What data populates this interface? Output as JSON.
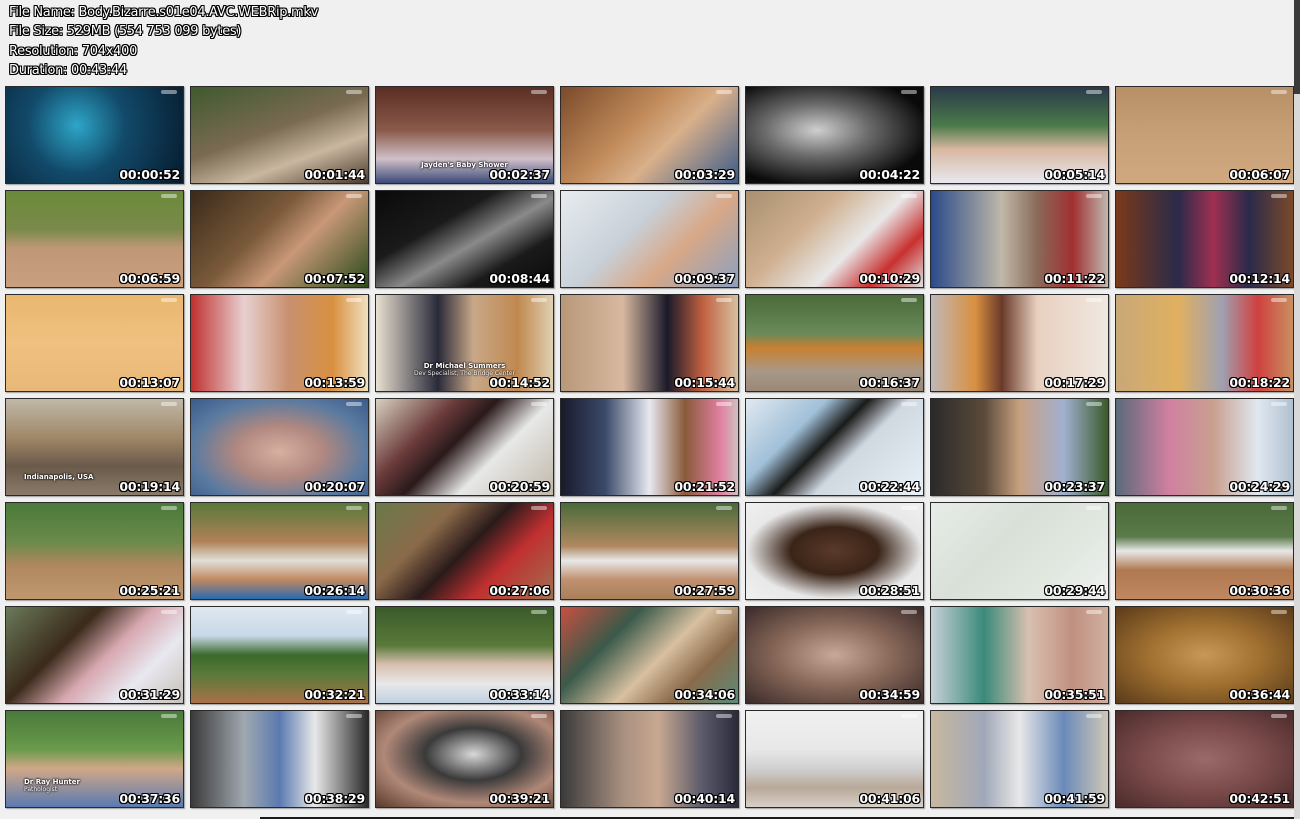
{
  "header": {
    "file_name": "File Name: Body.Bizarre.s01e04.AVC.WEBRip.mkv",
    "file_size": "File Size: 529MB (554 753 099 bytes)",
    "resolution": "Resolution: 704x400",
    "duration": "Duration: 00:43:44"
  },
  "thumbnails": [
    {
      "time": "00:00:52",
      "bg": "radial-gradient(circle at 40% 40%, #2ea6c8 0%, #124a6a 40%, #061a2c 100%)"
    },
    {
      "time": "00:01:44",
      "bg": "linear-gradient(160deg, #3f5a2e 0%, #7a6a52 45%, #c9b7a0 70%, #4b3a2c 100%)"
    },
    {
      "time": "00:02:37",
      "caption": "Jayden's Baby Shower",
      "bg": "linear-gradient(180deg, #5a2e24 0%, #8a5a4a 45%, #d0c0c8 75%, #3a4a78 100%)"
    },
    {
      "time": "00:03:29",
      "bg": "linear-gradient(135deg, #7a4a2a 0%, #c08a5a 40%, #d9b08a 60%, #3a5a8a 100%)"
    },
    {
      "time": "00:04:22",
      "bg": "radial-gradient(ellipse at 40% 45%, #cfcfcf 0%, #6a6a6a 35%, #0a0a0a 75%)"
    },
    {
      "time": "00:05:14",
      "bg": "linear-gradient(180deg, #2a3a4a 0%, #4a7a4a 40%, #d8b8a0 65%, #e8e8f0 100%)"
    },
    {
      "time": "00:06:07",
      "bg": "linear-gradient(180deg, #b89068 0%, #c8a078 50%, #d0a880 100%)"
    },
    {
      "time": "00:06:59",
      "bg": "linear-gradient(180deg, #6a8a3a 0%, #7a8a4a 40%, #c09878 60%, #c8a080 100%)"
    },
    {
      "time": "00:07:52",
      "bg": "linear-gradient(135deg, #3a2a1a 0%, #7a5a3a 40%, #c89878 60%, #2a4a1a 100%)"
    },
    {
      "time": "00:08:44",
      "bg": "linear-gradient(150deg, #0a0a0a 0%, #1a1a1a 35%, #8a8a8a 55%, #1a1a1a 75%, #0a0a0a 100%)"
    },
    {
      "time": "00:09:37",
      "bg": "linear-gradient(135deg, #e8ecf0 0%, #c8d0d8 40%, #d8a888 65%, #8aa0c0 100%)"
    },
    {
      "time": "00:10:29",
      "bg": "linear-gradient(135deg, #a89070 0%, #d0b090 35%, #e8e8e8 60%, #c83030 80%, #e0e0e0 100%)"
    },
    {
      "time": "00:11:22",
      "bg": "linear-gradient(90deg, #2a4a8a 0%, #c0b8a8 40%, #8a6a5a 60%, #a03030 80%, #c0b8b0 100%)"
    },
    {
      "time": "00:12:14",
      "bg": "linear-gradient(90deg, #7a3a1a 0%, #2a2a4a 35%, #a03050 55%, #2a2a4a 75%, #7a4a2a 100%)"
    },
    {
      "time": "00:13:07",
      "bg": "linear-gradient(180deg, #e8b870 0%, #f0c080 50%, #e8b878 100%)"
    },
    {
      "time": "00:13:59",
      "bg": "linear-gradient(90deg, #c03030 0%, #e8d0d0 30%, #c89070 55%, #d89040 80%, #f0e0c0 100%)"
    },
    {
      "time": "00:14:52",
      "caption": "Dr Michael Summers",
      "caption2": "Dev Specialist, The Bridge Center",
      "bg": "linear-gradient(90deg, #e8e0d0 0%, #2a2a3a 35%, #c8a888 55%, #c08850 80%, #e0d0b0 100%)"
    },
    {
      "time": "00:15:44",
      "bg": "linear-gradient(90deg, #b89878 0%, #d8b8a0 35%, #1a1a2a 60%, #c06040 80%, #d8c0a0 100%)"
    },
    {
      "time": "00:16:37",
      "bg": "linear-gradient(180deg, #4a6a3a 0%, #6a8a5a 40%, #c88030 55%, #a89888 80%, #9a8878 100%)"
    },
    {
      "time": "00:17:29",
      "bg": "linear-gradient(90deg, #c0b8b8 0%, #d89040 25%, #6a3a2a 40%, #e8d0c0 60%, #f0e8e0 100%)"
    },
    {
      "time": "00:18:22",
      "bg": "linear-gradient(90deg, #c8a878 0%, #e0b060 35%, #a0a0b0 60%, #d04040 80%, #c89060 100%)"
    },
    {
      "time": "00:19:14",
      "caption": "Indianapolis, USA",
      "caption_left": true,
      "bg": "linear-gradient(180deg, #c0b8a8 0%, #a08868 40%, #6a5a4a 70%, #8a7a6a 100%)"
    },
    {
      "time": "00:20:07",
      "bg": "radial-gradient(ellipse at 50% 55%, #d8b0a0 0%, #b08880 35%, #5a7aa0 70%, #3a5a8a 100%)"
    },
    {
      "time": "00:20:59",
      "bg": "linear-gradient(135deg, #d8d0c0 0%, #6a3a3a 30%, #2a1a1a 45%, #e8e8e8 65%, #c0b8a8 100%)"
    },
    {
      "time": "00:21:52",
      "bg": "linear-gradient(90deg, #1a1a2a 0%, #3a4a6a 25%, #e8e8f0 50%, #8a5a3a 70%, #e080a0 90%, #d0c0c0 100%)"
    },
    {
      "time": "00:22:44",
      "bg": "linear-gradient(135deg, #e0e8f0 0%, #a0c0d8 30%, #1a1a1a 45%, #d0d8e0 60%, #e8f0f8 100%)"
    },
    {
      "time": "00:23:37",
      "bg": "linear-gradient(90deg, #2a2a2a 0%, #5a4a3a 30%, #c8a080 50%, #a0b0d0 75%, #3a5a2a 100%)"
    },
    {
      "time": "00:24:29",
      "bg": "linear-gradient(90deg, #5a6a7a 0%, #d080a0 30%, #c8a090 55%, #e0e8f0 80%, #b0c0d0 100%)"
    },
    {
      "time": "00:25:21",
      "bg": "linear-gradient(180deg, #4a7a3a 0%, #6a8a4a 40%, #b08860 65%, #c09870 100%)"
    },
    {
      "time": "00:26:14",
      "bg": "linear-gradient(180deg, #5a7a3a 0%, #b08058 40%, #e0e0d8 60%, #c08860 80%, #2a6ab0 100%)"
    },
    {
      "time": "00:27:06",
      "bg": "linear-gradient(135deg, #6a7a4a 0%, #8a6a4a 30%, #2a1a1a 50%, #c03030 70%, #a07050 100%)"
    },
    {
      "time": "00:27:59",
      "bg": "linear-gradient(180deg, #4a6a3a 0%, #b08860 45%, #e8e8e8 60%, #c09070 80%, #a88058 100%)"
    },
    {
      "time": "00:28:51",
      "bg": "radial-gradient(ellipse at 50% 50%, #5a3a2a 0%, #3a2418 35%, #e8e8e8 70%, #f0f0f0 100%)"
    },
    {
      "time": "00:29:44",
      "bg": "linear-gradient(135deg, #e8ece8 0%, #d8e0d8 40%, #e0e8e0 70%, #f0f0f0 100%)"
    },
    {
      "time": "00:30:36",
      "bg": "linear-gradient(180deg, #4a6a3a 0%, #5a7a4a 35%, #e8e8e8 50%, #b07850 70%, #c08860 100%)"
    },
    {
      "time": "00:31:29",
      "bg": "linear-gradient(135deg, #6a7a5a 0%, #3a2a1a 35%, #d8a8b0 55%, #e8e8f0 75%, #c8c0b8 100%)"
    },
    {
      "time": "00:32:21",
      "bg": "linear-gradient(180deg, #e0e8f0 0%, #c8d8e8 30%, #3a6a2a 50%, #5a7a3a 70%, #a87048 100%)"
    },
    {
      "time": "00:33:14",
      "bg": "linear-gradient(180deg, #3a5a2a 0%, #5a7a3a 40%, #d8c0b0 60%, #e8e8e8 80%, #c0d0e0 100%)"
    },
    {
      "time": "00:34:06",
      "bg": "linear-gradient(135deg, #c85040 0%, #3a5a4a 30%, #d8c0a0 55%, #8a6a4a 75%, #5a8a7a 100%)"
    },
    {
      "time": "00:34:59",
      "bg": "radial-gradient(ellipse at 50% 50%, #c8a898 0%, #8a6a5a 45%, #3a2a2a 100%)"
    },
    {
      "time": "00:35:51",
      "bg": "linear-gradient(90deg, #c8d0d8 0%, #3a8a7a 30%, #d8c0b0 55%, #c09080 80%, #d0b0a0 100%)"
    },
    {
      "time": "00:36:44",
      "bg": "radial-gradient(ellipse at 50% 50%, #c89858 0%, #a07030 45%, #5a3a1a 100%)"
    },
    {
      "time": "00:37:36",
      "caption": "Dr Ray Hunter",
      "caption2": "Pathologist",
      "caption_left": true,
      "bg": "linear-gradient(180deg, #4a7a3a 0%, #6a9a4a 40%, #d0a888 60%, #5a7ab0 100%)"
    },
    {
      "time": "00:38:29",
      "bg": "linear-gradient(90deg, #3a3a3a 0%, #a0a8b0 30%, #5a7ab0 50%, #e8e8e8 70%, #2a2a2a 100%)"
    },
    {
      "time": "00:39:21",
      "bg": "radial-gradient(ellipse at 55% 45%, #d8d8d8 0%, #3a3a3a 35%, #b08878 65%, #5a3a2a 100%)"
    },
    {
      "time": "00:40:14",
      "bg": "linear-gradient(90deg, #3a3a3a 0%, #a89080 35%, #c8a890 55%, #5a5a6a 80%, #2a2a3a 100%)"
    },
    {
      "time": "00:41:06",
      "bg": "linear-gradient(180deg, #f0f0f0 0%, #e8e8e8 40%, #d0d0d0 60%, #b8a898 80%, #d8d0c8 100%)"
    },
    {
      "time": "00:41:59",
      "bg": "linear-gradient(90deg, #c8b8a0 0%, #a0a8b8 30%, #e8e8e8 50%, #6a8ab8 75%, #d0c8b8 100%)"
    },
    {
      "time": "00:42:51",
      "bg": "radial-gradient(ellipse at 50% 50%, #9a6a6a 0%, #7a4a4a 50%, #4a2a2a 100%)"
    }
  ]
}
